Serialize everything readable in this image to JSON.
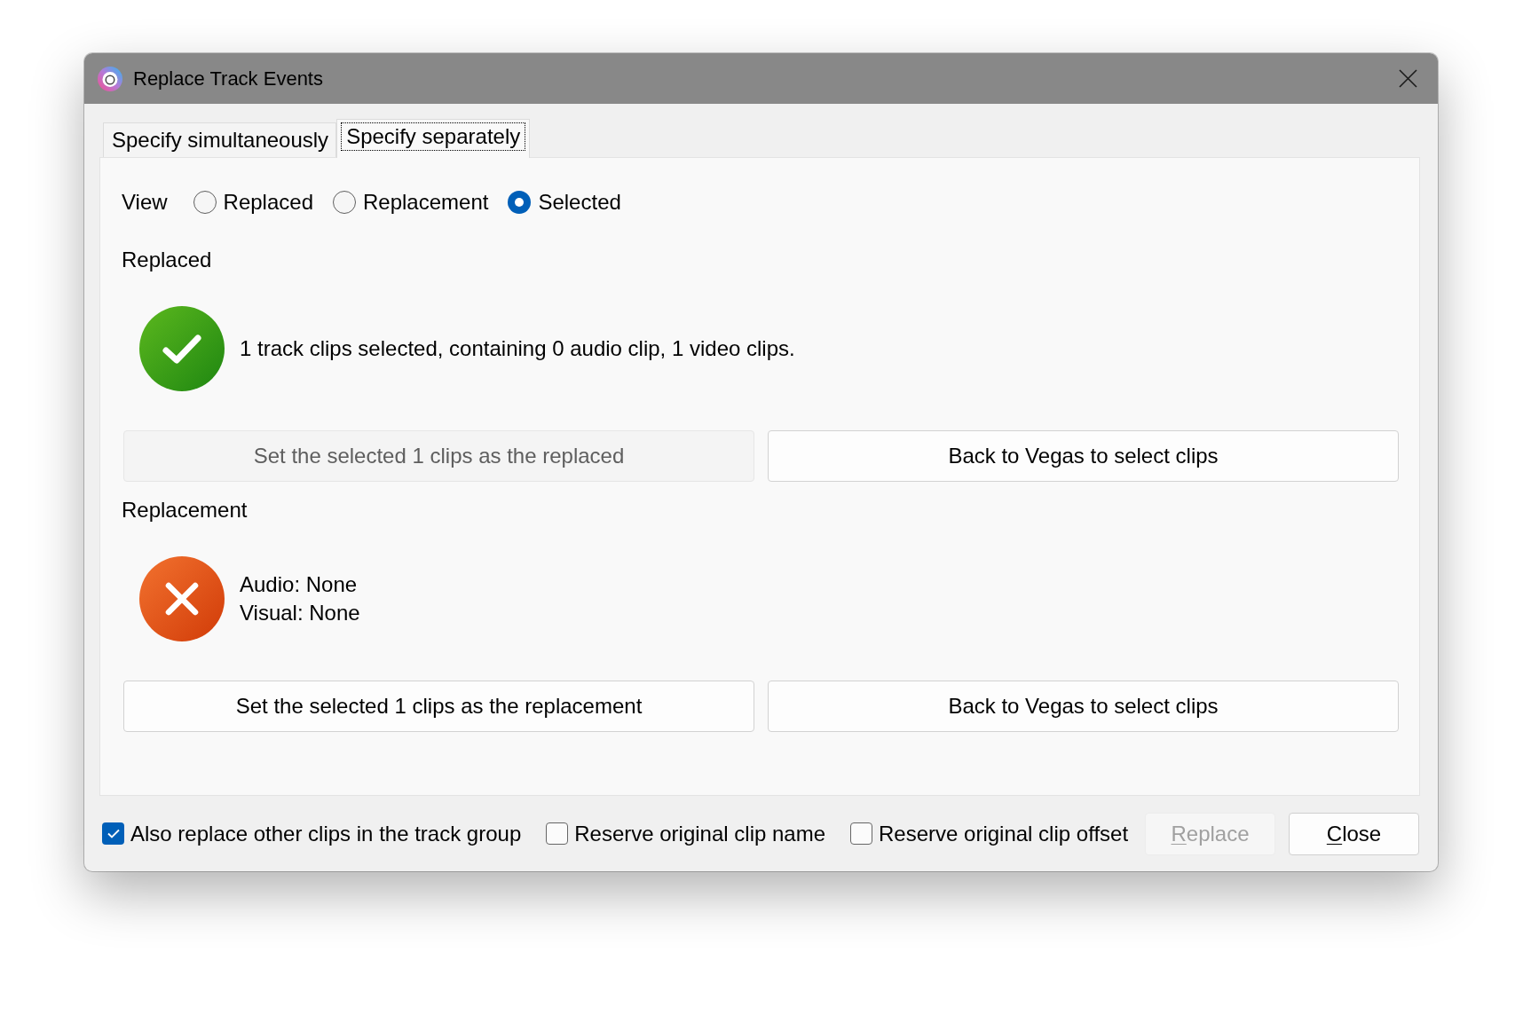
{
  "window": {
    "title": "Replace Track Events"
  },
  "tabs": [
    {
      "label": "Specify simultaneously",
      "selected": false,
      "focused": false
    },
    {
      "label": "Specify separately",
      "selected": true,
      "focused": true
    }
  ],
  "view": {
    "label": "View",
    "options": [
      {
        "label": "Replaced",
        "selected": false
      },
      {
        "label": "Replacement",
        "selected": false
      },
      {
        "label": "Selected",
        "selected": true
      }
    ]
  },
  "sections": [
    {
      "heading": "Replaced",
      "status": {
        "kind": "success",
        "lines": [
          "1 track clips selected, containing 0 audio clip, 1 video clips."
        ]
      },
      "buttons": [
        {
          "label": "Set the selected 1 clips as the replaced",
          "disabled": true
        },
        {
          "label": "Back to Vegas to select clips",
          "disabled": false
        }
      ]
    },
    {
      "heading": "Replacement",
      "status": {
        "kind": "error",
        "lines": [
          "Audio: None",
          "Visual: None"
        ]
      },
      "buttons": [
        {
          "label": "Set the selected 1 clips as the replacement",
          "disabled": false
        },
        {
          "label": "Back to Vegas to select clips",
          "disabled": false
        }
      ]
    }
  ],
  "options": [
    {
      "label": "Also replace other clips in the track group",
      "checked": true
    },
    {
      "label": "Reserve original clip name",
      "checked": false
    },
    {
      "label": "Reserve original clip offset",
      "checked": false
    }
  ],
  "buttons": [
    {
      "label": "Replace",
      "disabled": true,
      "mnemonic_underlined": true
    },
    {
      "label": "Close",
      "disabled": false,
      "mnemonic_underlined": true
    }
  ]
}
